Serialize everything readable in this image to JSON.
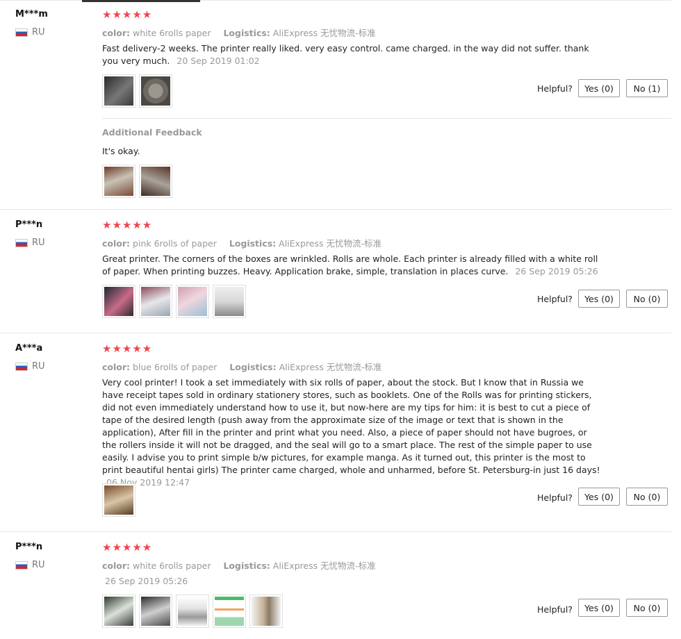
{
  "helpful_label": "Helpful?",
  "reviews": [
    {
      "user": "M***m",
      "country": "RU",
      "stars": "★★★★★",
      "color_label": "color:",
      "color_value": "white 6rolls paper",
      "logistics_label": "Logistics:",
      "logistics_value": "AliExpress 无忧物流-标准",
      "text": "Fast delivery-2 weeks. The printer really liked. very easy control. came charged. in the way did not suffer. thank you very much.",
      "date": "20 Sep 2019 01:02",
      "yes_label": "Yes (0)",
      "no_label": "No (1)",
      "additional_title": "Additional Feedback",
      "additional_text": "It's okay."
    },
    {
      "user": "P***n",
      "country": "RU",
      "stars": "★★★★★",
      "color_label": "color:",
      "color_value": "pink 6rolls of paper",
      "logistics_label": "Logistics:",
      "logistics_value": "AliExpress 无忧物流-标准",
      "text": "Great printer. The corners of the boxes are wrinkled. Rolls are whole. Each printer is already filled with a white roll of paper. When printing buzzes. Heavy. Application brake, simple, translation in places curve.",
      "date": "26 Sep 2019 05:26",
      "yes_label": "Yes (0)",
      "no_label": "No (0)"
    },
    {
      "user": "A***a",
      "country": "RU",
      "stars": "★★★★★",
      "color_label": "color:",
      "color_value": "blue 6rolls of paper",
      "logistics_label": "Logistics:",
      "logistics_value": "AliExpress 无忧物流-标准",
      "text": "Very cool printer! I took a set immediately with six rolls of paper, about the stock. But I know that in Russia we have receipt tapes sold in ordinary stationery stores, such as booklets. One of the Rolls was for printing stickers, did not even immediately understand how to use it, but now-here are my tips for him: it is best to cut a piece of tape of the desired length (push away from the approximate size of the image or text that is shown in the application), After fill in the printer and print what you need. Also, a piece of paper should not have bugroes, or the rollers inside it will not be dragged, and the seal will go to a smart place. The rest of the simple paper to use easily. I advise you to print simple b/w pictures, for example manga. As it turned out, this printer is the most to print beautiful hentai girls) The printer came charged, whole and unharmed, before St. Petersburg-in just 16 days!",
      "date": "06 Nov 2019 12:47",
      "yes_label": "Yes (0)",
      "no_label": "No (0)"
    },
    {
      "user": "P***n",
      "country": "RU",
      "stars": "★★★★★",
      "color_label": "color:",
      "color_value": "white 6rolls paper",
      "logistics_label": "Logistics:",
      "logistics_value": "AliExpress 无忧物流-标准",
      "date": "26 Sep 2019 05:26",
      "yes_label": "Yes (0)",
      "no_label": "No (0)"
    }
  ]
}
